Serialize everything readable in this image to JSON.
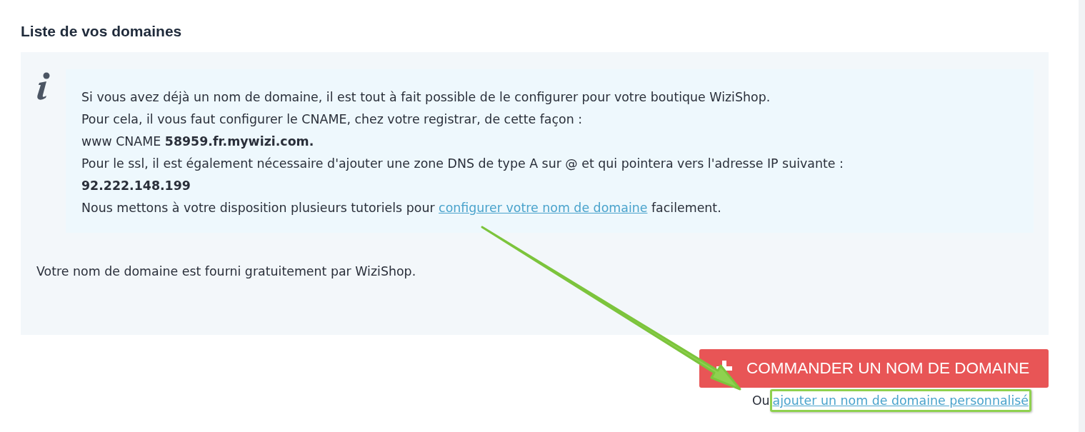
{
  "heading": "Liste de vos domaines",
  "info": {
    "lines": [
      {
        "kind": "text",
        "text": "Si vous avez déjà un nom de domaine, il est tout à fait possible de le configurer pour votre boutique WiziShop."
      },
      {
        "kind": "text",
        "text": "Pour cela, il vous faut configurer le CNAME, chez votre registrar, de cette façon :"
      },
      {
        "kind": "text",
        "text": "www CNAME **58959.fr.mywizi.com.**"
      },
      {
        "kind": "text",
        "text": "Pour le ssl, il est également nécessaire d'ajouter une zone DNS de type A sur @ et qui pointera vers l'adresse IP suivante :"
      },
      {
        "kind": "text",
        "text": "**92.222.148.199**"
      },
      {
        "kind": "link",
        "before": "Nous mettons à votre disposition plusieurs tutoriels pour",
        "link": "configurer votre nom de domaine",
        "after": "facilement."
      }
    ]
  },
  "note": "Votre nom de domaine est fourni gratuitement par WiziShop.",
  "order_button": {
    "label": "COMMANDER UN NOM DE DOMAINE"
  },
  "custom": {
    "prefix": "Ou",
    "link": "ajouter un nom de domaine personnalisé",
    "highlighted": true
  },
  "annotation": {
    "kind": "arrow"
  }
}
